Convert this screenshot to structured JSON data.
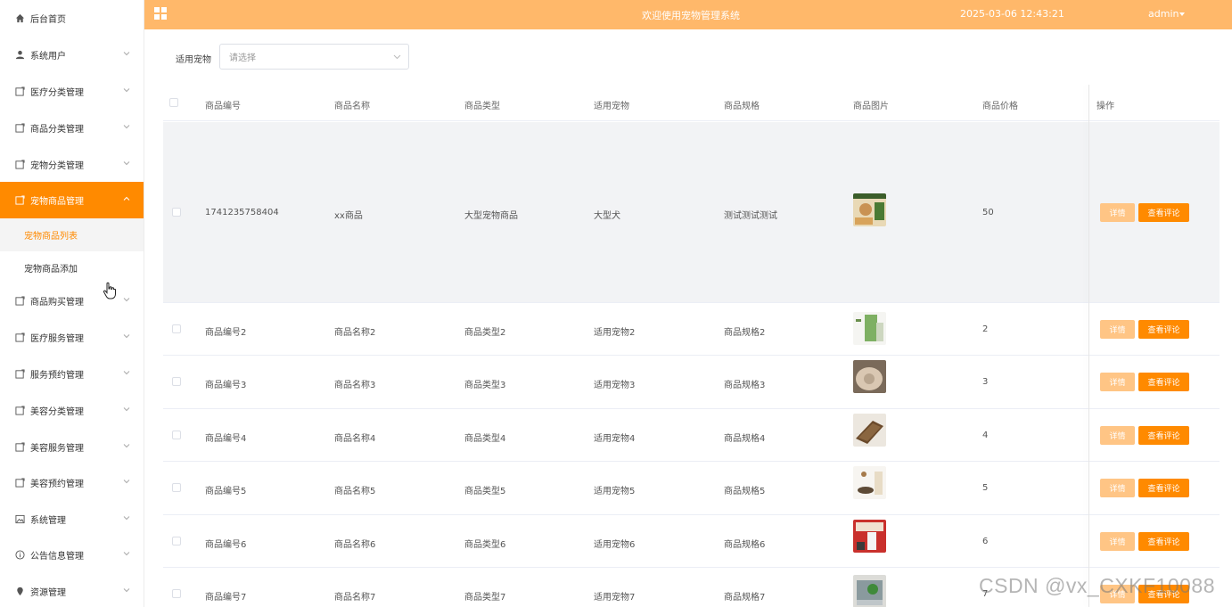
{
  "header": {
    "title": "欢迎使用宠物管理系统",
    "datetime": "2025-03-06 12:43:21",
    "user": "admin"
  },
  "sidebar": {
    "items": [
      {
        "label": "后台首页",
        "icon": "home-icon"
      },
      {
        "label": "系统用户",
        "icon": "user-icon"
      },
      {
        "label": "医疗分类管理",
        "icon": "folder-icon"
      },
      {
        "label": "商品分类管理",
        "icon": "folder-icon"
      },
      {
        "label": "宠物分类管理",
        "icon": "folder-icon"
      },
      {
        "label": "宠物商品管理",
        "icon": "folder-icon",
        "active": true
      },
      {
        "label": "商品购买管理",
        "icon": "folder-icon"
      },
      {
        "label": "医疗服务管理",
        "icon": "folder-icon"
      },
      {
        "label": "服务预约管理",
        "icon": "folder-icon"
      },
      {
        "label": "美容分类管理",
        "icon": "folder-icon"
      },
      {
        "label": "美容服务管理",
        "icon": "folder-icon"
      },
      {
        "label": "美容预约管理",
        "icon": "folder-icon"
      },
      {
        "label": "系统管理",
        "icon": "image-icon"
      },
      {
        "label": "公告信息管理",
        "icon": "info-icon"
      },
      {
        "label": "资源管理",
        "icon": "location-icon"
      }
    ],
    "submenu": [
      {
        "label": "宠物商品列表",
        "current": true
      },
      {
        "label": "宠物商品添加"
      }
    ]
  },
  "filter": {
    "label": "适用宠物",
    "placeholder": "请选择"
  },
  "table": {
    "columns": [
      "商品编号",
      "商品名称",
      "商品类型",
      "适用宠物",
      "商品规格",
      "商品图片",
      "商品价格",
      "操作"
    ],
    "actions": {
      "detail": "详情",
      "review": "查看评论"
    },
    "rows": [
      {
        "id": "1741235758404",
        "name": "xx商品",
        "type": "大型宠物商品",
        "pet": "大型犬",
        "spec": "测试测试测试",
        "price": "50"
      },
      {
        "id": "商品编号2",
        "name": "商品名称2",
        "type": "商品类型2",
        "pet": "适用宠物2",
        "spec": "商品规格2",
        "price": "2"
      },
      {
        "id": "商品编号3",
        "name": "商品名称3",
        "type": "商品类型3",
        "pet": "适用宠物3",
        "spec": "商品规格3",
        "price": "3"
      },
      {
        "id": "商品编号4",
        "name": "商品名称4",
        "type": "商品类型4",
        "pet": "适用宠物4",
        "spec": "商品规格4",
        "price": "4"
      },
      {
        "id": "商品编号5",
        "name": "商品名称5",
        "type": "商品类型5",
        "pet": "适用宠物5",
        "spec": "商品规格5",
        "price": "5"
      },
      {
        "id": "商品编号6",
        "name": "商品名称6",
        "type": "商品类型6",
        "pet": "适用宠物6",
        "spec": "商品规格6",
        "price": "6"
      },
      {
        "id": "商品编号7",
        "name": "商品名称7",
        "type": "商品类型7",
        "pet": "适用宠物7",
        "spec": "商品规格7",
        "price": "7"
      }
    ]
  },
  "colors": {
    "accent": "#ff8a00",
    "header_bg": "#ffb86a",
    "detail_btn": "#ffc585"
  },
  "watermark": "CSDN @vx_CXKF10088"
}
